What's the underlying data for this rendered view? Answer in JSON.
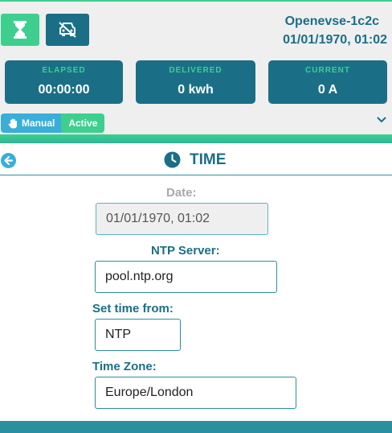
{
  "header": {
    "device_name": "Openevse-1c2c",
    "device_time": "01/01/1970, 01:02"
  },
  "stats": [
    {
      "label": "ELAPSED",
      "value": "00:00:00"
    },
    {
      "label": "DELIVERED",
      "value": "0 kwh"
    },
    {
      "label": "CURRENT",
      "value": "0 A"
    }
  ],
  "mode": {
    "manual_label": "Manual",
    "active_label": "Active"
  },
  "section": {
    "title": "TIME"
  },
  "form": {
    "date_label": "Date:",
    "date_value": "01/01/1970, 01:02",
    "ntp_label": "NTP Server:",
    "ntp_value": "pool.ntp.org",
    "set_from_label": "Set time from:",
    "set_from_value": "NTP",
    "tz_label": "Time Zone:",
    "tz_value": "Europe/London"
  },
  "colors": {
    "accent_green": "#3ecf8e",
    "primary_teal": "#1a6f87",
    "manual_blue": "#3aaed8"
  }
}
